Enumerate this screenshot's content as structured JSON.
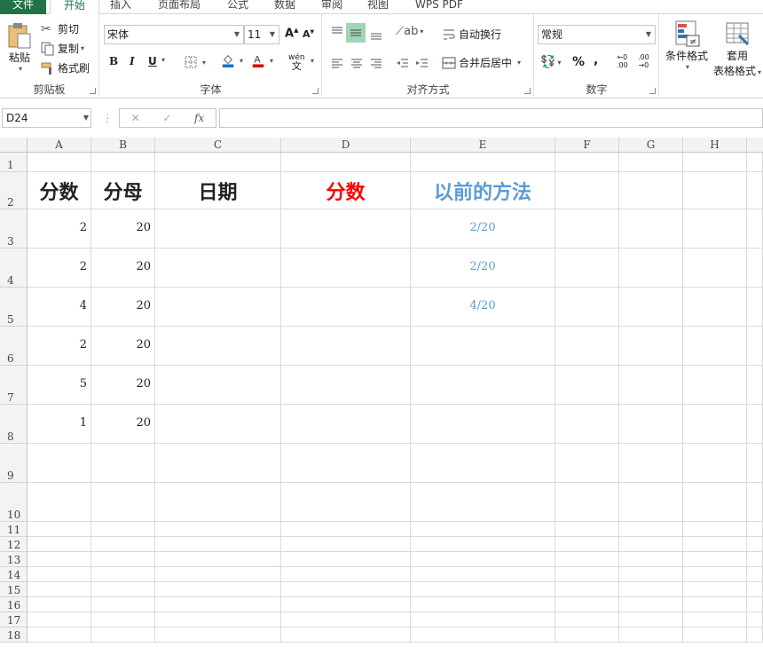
{
  "tabs": [
    "文件",
    "开始",
    "插入",
    "页面布局",
    "公式",
    "数据",
    "审阅",
    "视图",
    "WPS PDF"
  ],
  "clipboard": {
    "paste": "粘贴",
    "cut": "剪切",
    "copy": "复制",
    "format_painter": "格式刷",
    "label": "剪贴板"
  },
  "font": {
    "name": "宋体",
    "size": "11",
    "bold": "B",
    "italic": "I",
    "underline": "U",
    "phonetic": "wén",
    "label": "字体"
  },
  "alignment": {
    "wrap": "自动换行",
    "merge": "合并后居中",
    "label": "对齐方式"
  },
  "number": {
    "format": "常规",
    "percent": "%",
    "comma": ",",
    "inc_dec": ".00",
    "label": "数字"
  },
  "styles": {
    "conditional": "条件格式",
    "table_format_1": "套用",
    "table_format_2": "表格格式"
  },
  "formula_bar": {
    "name_box": "D24",
    "fx": "fx",
    "value": ""
  },
  "columns": [
    "A",
    "B",
    "C",
    "D",
    "E",
    "F",
    "G",
    "H"
  ],
  "rows": [
    "1",
    "2",
    "3",
    "4",
    "5",
    "6",
    "7",
    "8",
    "9",
    "10",
    "11",
    "12",
    "13",
    "14",
    "15",
    "16",
    "17",
    "18"
  ],
  "headers": {
    "a": "分数",
    "b": "分母",
    "c": "日期",
    "d": "分数",
    "e": "以前的方法"
  },
  "header_colors": {
    "d": "#ff0000",
    "e": "#5b9bd5"
  },
  "data_rows": [
    {
      "a": "2",
      "b": "20",
      "e": "2/20"
    },
    {
      "a": "2",
      "b": "20",
      "e": "2/20"
    },
    {
      "a": "4",
      "b": "20",
      "e": "4/20"
    },
    {
      "a": "2",
      "b": "20",
      "e": ""
    },
    {
      "a": "5",
      "b": "20",
      "e": ""
    },
    {
      "a": "1",
      "b": "20",
      "e": ""
    }
  ]
}
